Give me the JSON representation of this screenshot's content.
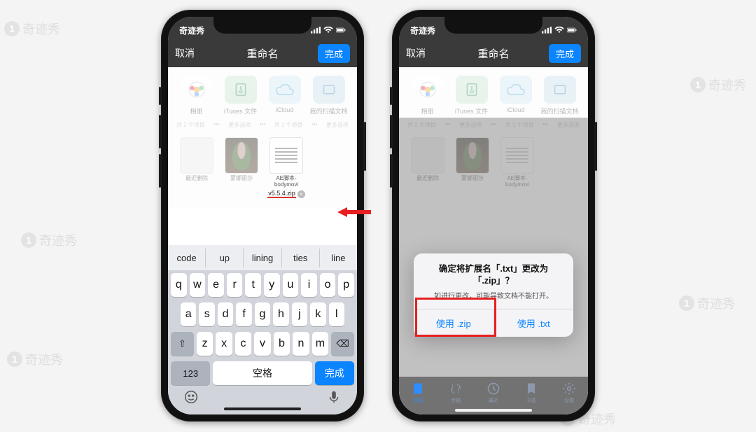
{
  "watermark": "奇迹秀",
  "statusbar": {
    "carrier": "奇迹秀"
  },
  "navbar": {
    "cancel": "取消",
    "title": "重命名",
    "done": "完成"
  },
  "locations": {
    "items": [
      {
        "label": "相册"
      },
      {
        "label": "iTunes 文件"
      },
      {
        "label": "iCloud"
      },
      {
        "label": "我的扫描文档"
      }
    ],
    "meta_left": "共 2 个项目",
    "meta_dots": "•••",
    "meta_sort": "更多选项",
    "meta_count": "共 1 个项目",
    "meta_update": "更多选项"
  },
  "files": {
    "f1": {
      "label": "最近删除"
    },
    "f2": {
      "label": "蒙娜丽莎"
    },
    "f3": {
      "label_line1": "AE脚本-",
      "label_line2": "bodymovi",
      "rename_value": "v5.5.4.zip"
    }
  },
  "keyboard": {
    "suggestions": [
      "code",
      "up",
      "lining",
      "ties",
      "line"
    ],
    "row1": [
      "q",
      "w",
      "e",
      "r",
      "t",
      "y",
      "u",
      "i",
      "o",
      "p"
    ],
    "row2": [
      "a",
      "s",
      "d",
      "f",
      "g",
      "h",
      "j",
      "k",
      "l"
    ],
    "row3": [
      "z",
      "x",
      "c",
      "v",
      "b",
      "n",
      "m"
    ],
    "shift": "⇧",
    "backspace": "⌫",
    "numkey": "123",
    "space": "空格",
    "done": "完成"
  },
  "dialog": {
    "title": "确定将扩展名「.txt」更改为「.zip」？",
    "message": "如进行更改，可能导致文档不能打开。",
    "btn_zip": "使用 .zip",
    "btn_txt": "使用 .txt"
  },
  "tabs": {
    "t1": "文档",
    "t2": "传输",
    "t3": "最近",
    "t4": "书签",
    "t5": "设置"
  }
}
